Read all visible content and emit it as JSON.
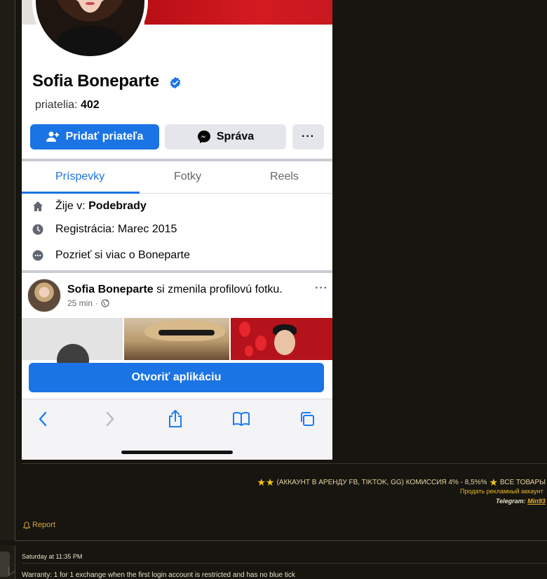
{
  "profile": {
    "name": "Sofia Boneparte",
    "friends_label": "priatelia:",
    "friends_count": "402",
    "add_friend_label": "Pridať priateľa",
    "message_label": "Správa",
    "more_label": "···"
  },
  "tabs": [
    {
      "label": "Príspevky",
      "active": true
    },
    {
      "label": "Fotky",
      "active": false
    },
    {
      "label": "Reels",
      "active": false
    }
  ],
  "about": {
    "lives_prefix": "Žije v: ",
    "lives_city": "Podebrady",
    "registered": "Registrácia: Marec 2015",
    "see_more": "Pozrieť si viac o Boneparte"
  },
  "post": {
    "author": "Sofia Boneparte",
    "action": " si zmenila profilovú fotku.",
    "time": "25 min",
    "dot": "·",
    "more": "···"
  },
  "open_app_label": "Otvoriť aplikáciu",
  "safari_icons": [
    "back-icon",
    "forward-icon",
    "share-icon",
    "bookmarks-icon",
    "tabs-icon"
  ],
  "forum": {
    "signature_line1": "(АККАУНТ В АРЕНДУ FB, TIKTOK, GG) КОМИССИЯ 4% - 8,5%%",
    "signature_line1_tail": "ВСЕ ТОВАРЫ",
    "signature_line2": "Продать рекламный аккаунт",
    "signature_line3_label": "Telegram:",
    "signature_line3_link": "Min93",
    "report_label": "Report",
    "post_date": "Saturday at 11:35 PM",
    "post_text": "Warranty: 1 for 1 exchange when the first login account is restricted and has no blue tick"
  },
  "colors": {
    "fb_blue": "#1b74e4",
    "forum_bg": "#16150f",
    "accent_gold": "#e8b530"
  }
}
